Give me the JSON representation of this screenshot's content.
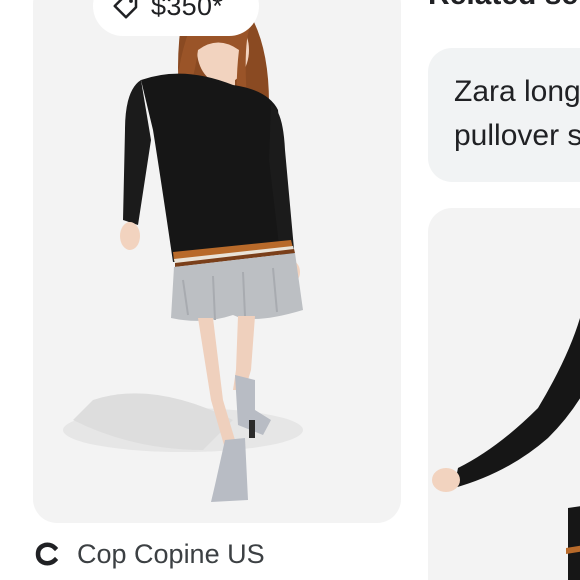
{
  "product": {
    "price": "$350*",
    "icons": {
      "price_tag": "tag-icon",
      "source_logo": "source-logo-icon"
    }
  },
  "source": {
    "name": "Cop Copine US"
  },
  "related": {
    "heading": "Related se",
    "chip_line1": "Zara long",
    "chip_line2": "pullover s"
  },
  "colors": {
    "card_background": "#f3f3f3",
    "chip_background": "#f1f3f4",
    "text_primary": "#202124",
    "text_secondary": "#3c4043"
  }
}
